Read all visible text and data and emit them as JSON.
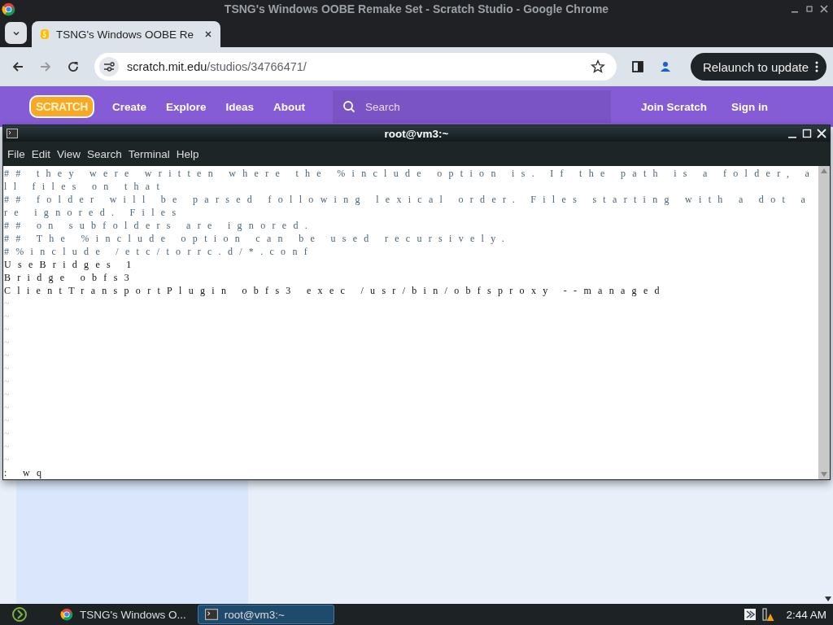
{
  "browser": {
    "title": "TSNG's Windows OOBE Remake Set - Scratch Studio - Google Chrome",
    "tabs": [
      {
        "label": "TSNG's Windows OOBE Re",
        "selected": true
      }
    ],
    "url": {
      "host": "scratch.mit.edu",
      "path": "/studios/34766471/"
    },
    "relaunch": "Relaunch to update"
  },
  "site_nav": {
    "logo": "SCRATCH",
    "links": [
      "Create",
      "Explore",
      "Ideas",
      "About"
    ],
    "search": {
      "placeholder": "Search"
    },
    "actions": [
      "Join Scratch",
      "Sign in"
    ]
  },
  "terminal": {
    "title": "root@vm3:~",
    "menu": [
      "File",
      "Edit",
      "View",
      "Search",
      "Terminal",
      "Help"
    ],
    "lines": [
      {
        "kind": "comment",
        "text": "## they were written where the %include option is. If the path is a folder, a"
      },
      {
        "kind": "comment",
        "text": "ll files on that"
      },
      {
        "kind": "comment",
        "text": "## folder will be parsed following lexical order. Files starting with a dot a"
      },
      {
        "kind": "comment",
        "text": "re ignored. Files"
      },
      {
        "kind": "comment",
        "text": "## on subfolders are ignored."
      },
      {
        "kind": "comment",
        "text": "## The %include option can be used recursively."
      },
      {
        "kind": "comment",
        "text": "#%include /etc/torrc.d/*.conf"
      },
      {
        "kind": "plain",
        "text": "UseBridges 1"
      },
      {
        "kind": "plain",
        "text": "Bridge obfs3"
      },
      {
        "kind": "plain",
        "text": "ClientTransportPlugin obfs3 exec /usr/bin/obfsproxy --managed"
      },
      {
        "kind": "empty",
        "text": "~"
      },
      {
        "kind": "empty",
        "text": "~"
      },
      {
        "kind": "empty",
        "text": "~"
      },
      {
        "kind": "empty",
        "text": "~"
      },
      {
        "kind": "empty",
        "text": "~"
      },
      {
        "kind": "empty",
        "text": "~"
      },
      {
        "kind": "empty",
        "text": "~"
      },
      {
        "kind": "empty",
        "text": "~"
      },
      {
        "kind": "empty",
        "text": "~"
      },
      {
        "kind": "empty",
        "text": "~"
      },
      {
        "kind": "empty",
        "text": "~"
      },
      {
        "kind": "empty",
        "text": "~"
      },
      {
        "kind": "empty",
        "text": "~"
      }
    ],
    "command": ": wq"
  },
  "taskbar": {
    "items": [
      {
        "label": "TSNG's Windows O...",
        "kind": "browser",
        "selected": false
      },
      {
        "label": "root@vm3:~",
        "kind": "terminal",
        "selected": true
      }
    ],
    "clock": "2:44 AM"
  }
}
